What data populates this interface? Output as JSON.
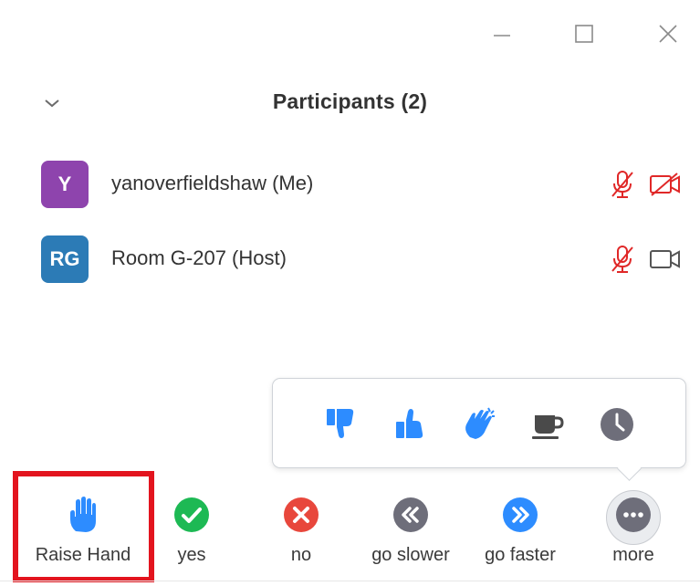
{
  "window": {
    "minimize_icon": "minimize-icon",
    "maximize_icon": "maximize-icon",
    "close_icon": "close-icon"
  },
  "panel": {
    "collapse_icon": "chevron-down-icon",
    "title": "Participants (2)"
  },
  "participants": [
    {
      "initials": "Y",
      "name": "yanoverfieldshaw (Me)",
      "avatar_color": "#8e44ad",
      "mic": "muted",
      "video": "off"
    },
    {
      "initials": "RG",
      "name": "Room G-207 (Host)",
      "avatar_color": "#2c7bb6",
      "mic": "muted",
      "video": "on"
    }
  ],
  "reactions": [
    "thumbs-down-icon",
    "thumbs-up-icon",
    "clap-icon",
    "coffee-icon",
    "clock-icon"
  ],
  "toolbar": {
    "raise_hand": "Raise Hand",
    "yes": "yes",
    "no": "no",
    "go_slower": "go slower",
    "go_faster": "go faster",
    "more": "more"
  },
  "colors": {
    "accent_blue": "#2d8cff",
    "muted_red": "#e02828",
    "yes_green": "#1db954",
    "no_red": "#e8473c",
    "slower_gray": "#6e6e7a",
    "highlight_red": "#e3141e"
  }
}
